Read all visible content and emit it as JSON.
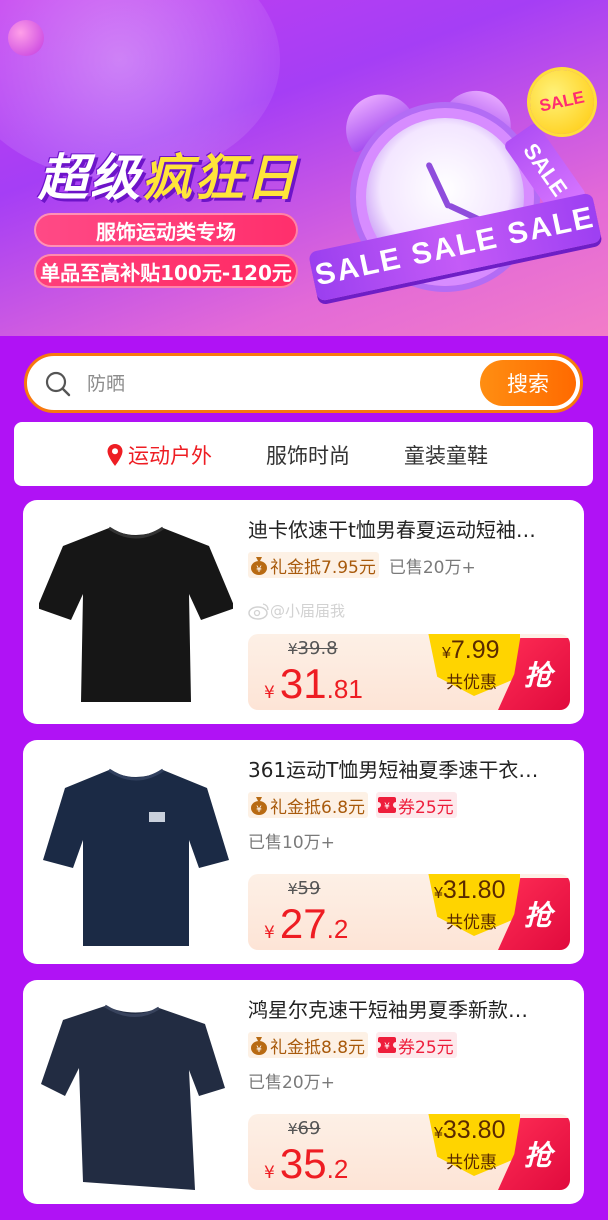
{
  "banner": {
    "title_part1": "超级",
    "title_part2": "疯狂日",
    "pill1": "服饰运动类专场",
    "pill2": "单品至高补贴100元-120元",
    "ribbon_text": "SALE SALE SALE",
    "ribbon_side": "SALE",
    "badge_text": "SALE"
  },
  "search": {
    "placeholder": "防晒",
    "button_label": "搜索"
  },
  "tabs": [
    {
      "label": "运动户外",
      "active": true
    },
    {
      "label": "服饰时尚",
      "active": false
    },
    {
      "label": "童装童鞋",
      "active": false
    }
  ],
  "products": [
    {
      "title": "迪卡侬速干t恤男春夏运动短袖…",
      "gift": "礼金抵7.95元",
      "sold": "已售20万+",
      "watermark": "@小届届我",
      "orig_price": "39.8",
      "price_int": "31",
      "price_dec": ".81",
      "discount": "7.99",
      "discount_label": "共优惠",
      "grab": "抢",
      "shirt_color": "#161616"
    },
    {
      "title": "361运动T恤男短袖夏季速干衣…",
      "gift": "礼金抵6.8元",
      "coupon": "券25元",
      "sold": "已售10万+",
      "orig_price": "59",
      "price_int": "27",
      "price_dec": ".2",
      "discount": "31.80",
      "discount_label": "共优惠",
      "grab": "抢",
      "shirt_color": "#1b2a45"
    },
    {
      "title": "鸿星尔克速干短袖男夏季新款…",
      "gift": "礼金抵8.8元",
      "coupon": "券25元",
      "sold": "已售20万+",
      "orig_price": "69",
      "price_int": "35",
      "price_dec": ".2",
      "discount": "33.80",
      "discount_label": "共优惠",
      "grab": "抢",
      "shirt_color": "#222c42"
    }
  ],
  "currency_symbol": "¥",
  "colors": {
    "page_bg": "#b012f5",
    "accent_orange": "#ff7a00",
    "price_red": "#ee1d23"
  }
}
